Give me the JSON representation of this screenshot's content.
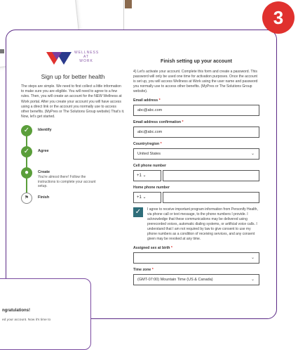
{
  "step_number": "3",
  "logo": {
    "line1": "WELLNESS",
    "line2": "AT",
    "line3": "WORK"
  },
  "left": {
    "title": "Sign up for better health",
    "intro": "The steps are simple. We need to first collect a little information to make sure you are eligible. You will need to agree to a few rules. Then, you will create an account for the NEW Wellness at Work portal. After you create your account you will have access using a direct link or the account you normally use to access other benefits. (MyPres or The Solutions Group website) That's it. Now, let's get started.",
    "steps": [
      {
        "label": "Identify",
        "desc": ""
      },
      {
        "label": "Agree",
        "desc": ""
      },
      {
        "label": "Create",
        "desc": "You're almost there! Follow the instructions to complete your account setup."
      },
      {
        "label": "Finish",
        "desc": ""
      }
    ]
  },
  "form": {
    "title": "Finish setting up your account",
    "intro": "4) Let's activate your account. Complete this form and create a password. This password will only be used one time for activation purposes. Once the account is set up, you will access Wellness at Work using the user name and password you normally use to access other benefits. (MyPres or The Solutions Group website).",
    "email_label": "Email address",
    "email_value": "abc@abc.com",
    "email_confirm_label": "Email address confirmation",
    "email_confirm_value": "abc@abc.com",
    "country_label": "Country/region",
    "country_value": "United States",
    "cell_label": "Cell phone number",
    "cell_cc": "+1",
    "home_label": "Home phone number",
    "home_cc": "+1",
    "consent_text": "I agree to receive important program information from Personify Health, via phone call or text message, to the phone numbers I provide. I acknowledge that these communications may be delivered using prerecorded voices, automatic dialing systems, or artificial voice calls. I understand that I am not required by law to give consent to use my phone numbers as a condition of receiving services, and any consent given may be revoked at any time.",
    "sex_label": "Assigned sex at birth",
    "sex_value": "",
    "tz_label": "Time zone",
    "tz_value": "(GMT-07:00) Mountain Time (US & Canada)",
    "required_mark": "*"
  },
  "congrats": {
    "title": "ngratulations!",
    "text": "ed your account. Now it's time to"
  },
  "colors": {
    "purple": "#5b2a86",
    "badge": "#e0312e",
    "green": "#5a9e3a",
    "teal": "#2f6e7a"
  }
}
